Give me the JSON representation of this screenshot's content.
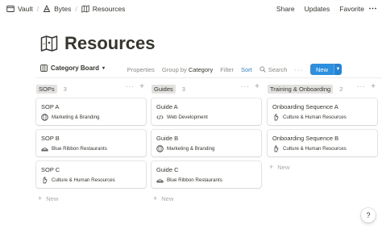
{
  "breadcrumbs": [
    {
      "label": "Vault",
      "icon": "vault-icon"
    },
    {
      "label": "Bytes",
      "icon": "bytes-icon"
    },
    {
      "label": "Resources",
      "icon": "resources-map-icon"
    }
  ],
  "top_actions": {
    "share": "Share",
    "updates": "Updates",
    "favorite": "Favorite"
  },
  "page": {
    "title": "Resources",
    "icon": "map-icon"
  },
  "view": {
    "name": "Category Board",
    "properties": "Properties",
    "group_by_prefix": "Group by",
    "group_by_value": "Category",
    "filter": "Filter",
    "sort": "Sort",
    "search": "Search",
    "more": "···",
    "new": "New"
  },
  "columns": [
    {
      "name": "SOPs",
      "count": "3",
      "cards": [
        {
          "title": "SOP A",
          "prop": "Marketing & Branding",
          "icon": "globe-icon"
        },
        {
          "title": "SOP B",
          "prop": "Blue Ribbon Restaurants",
          "icon": "dish-icon"
        },
        {
          "title": "SOP C",
          "prop": "Culture & Human Resources",
          "icon": "hand-icon"
        }
      ],
      "new_label": "New"
    },
    {
      "name": "Guides",
      "count": "3",
      "cards": [
        {
          "title": "Guide A",
          "prop": "Web Development",
          "icon": "code-icon"
        },
        {
          "title": "Guide B",
          "prop": "Marketing & Branding",
          "icon": "globe-icon"
        },
        {
          "title": "Guide C",
          "prop": "Blue Ribbon Restaurants",
          "icon": "dish-icon"
        }
      ],
      "new_label": "New"
    },
    {
      "name": "Training & Onboarding",
      "count": "2",
      "cards": [
        {
          "title": "Onboarding Sequence A",
          "prop": "Culture & Human Resources",
          "icon": "hand-icon"
        },
        {
          "title": "Onboarding Sequence B",
          "prop": "Culture & Human Resources",
          "icon": "hand-icon"
        }
      ],
      "new_label": "New"
    }
  ],
  "help": "?",
  "colors": {
    "accent": "#2e8fdf",
    "sort": "#2f80c8",
    "col_sops": "#e3e2e0",
    "col_guides": "#e3e2e0",
    "col_training": "#e3e2e0"
  }
}
